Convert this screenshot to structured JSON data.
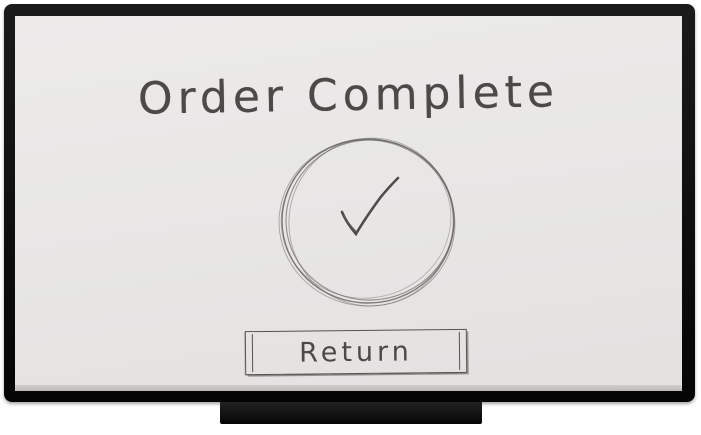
{
  "screen": {
    "title": "Order Complete",
    "status_icon": "checkmark-circle-icon",
    "return_button_label": "Return"
  },
  "colors": {
    "ink": "#4b4a48",
    "paper": "#e9e8e7",
    "frame": "#0d0d0d"
  }
}
